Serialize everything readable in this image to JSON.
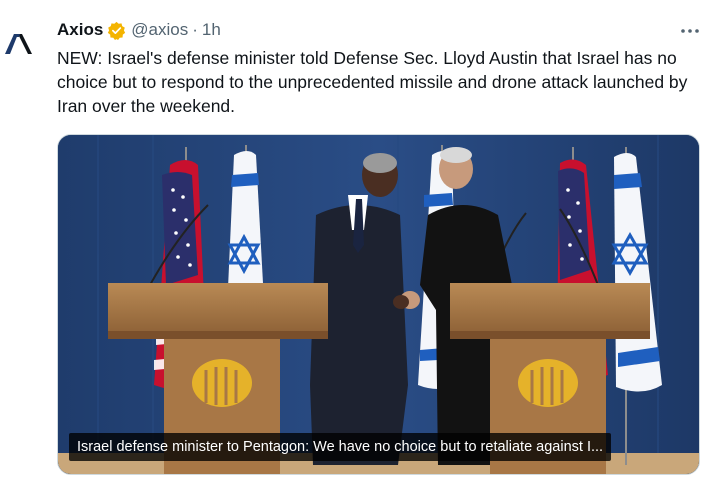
{
  "tweet": {
    "author_name": "Axios",
    "author_handle": "@axios",
    "separator": "·",
    "time": "1h",
    "text": "NEW: Israel's defense minister told Defense Sec. Lloyd Austin that Israel has no choice but to respond to the unprecedented missile and drone attack launched by Iran over the weekend.",
    "verified_badge_color": "#f4b400",
    "avatar_icon": "axios-logo-icon",
    "more_icon": "more-options-icon"
  },
  "media": {
    "caption": "Israel defense minister to Pentagon: We have no choice but to retaliate against I..."
  }
}
